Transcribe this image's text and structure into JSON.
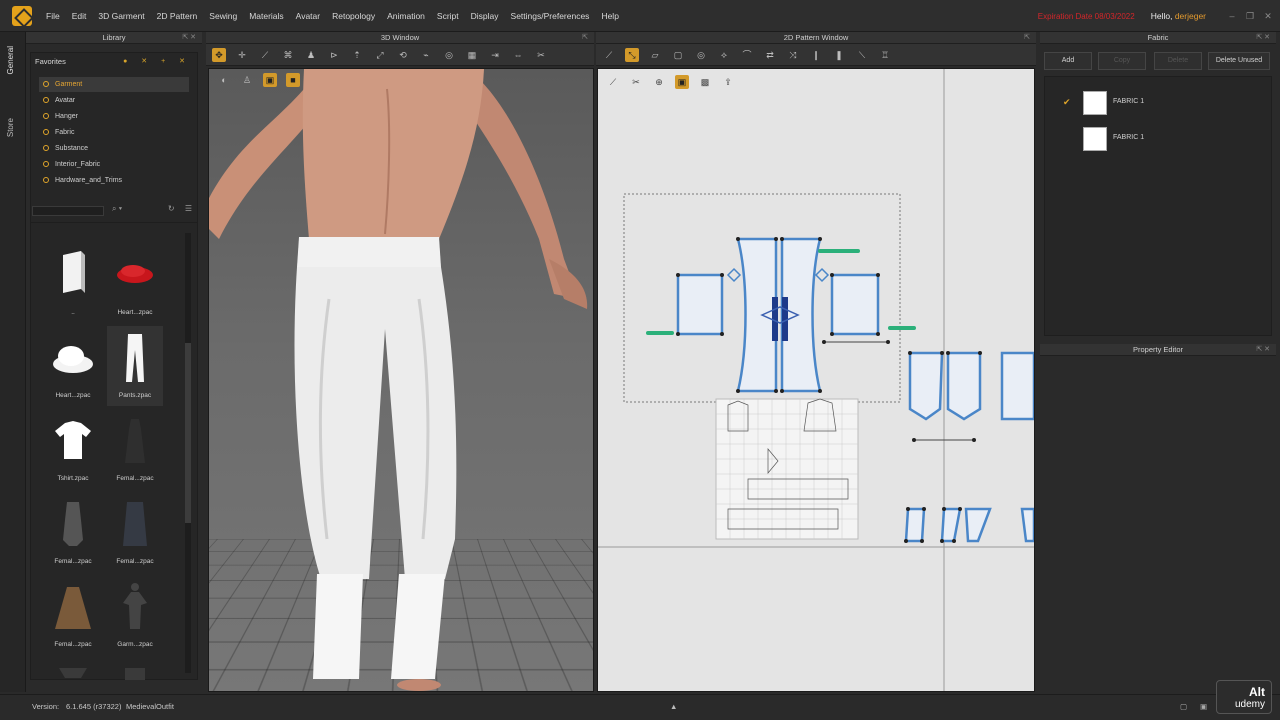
{
  "app": {
    "title": "CLO"
  },
  "menu": [
    "File",
    "Edit",
    "3D Garment",
    "2D Pattern",
    "Sewing",
    "Materials",
    "Avatar",
    "Retopology",
    "Animation",
    "Script",
    "Display",
    "Settings/Preferences",
    "Help"
  ],
  "header": {
    "expiration": "Expiration Date 08/03/2022",
    "hello": "Hello,",
    "user": "derjeger"
  },
  "side_tabs": {
    "general": "General",
    "store": "Store"
  },
  "library": {
    "title": "Library",
    "favorites_title": "Favorites",
    "favorites": [
      "Garment",
      "Avatar",
      "Hanger",
      "Fabric",
      "Substance",
      "Interior_Fabric",
      "Hardware_and_Trims"
    ],
    "selected": "Garment",
    "items": [
      {
        "label": ".."
      },
      {
        "label": "Heart...zpac"
      },
      {
        "label": "Heart...zpac"
      },
      {
        "label": "Pants.zpac"
      },
      {
        "label": "Tshirt.zpac"
      },
      {
        "label": "Femal...zpac"
      },
      {
        "label": "Femal...zpac"
      },
      {
        "label": "Femal...zpac"
      },
      {
        "label": "Femal...zpac"
      },
      {
        "label": "Garm...zpac"
      },
      {
        "label": ""
      },
      {
        "label": ""
      }
    ]
  },
  "window3d": {
    "title": "3D Window"
  },
  "window2d": {
    "title": "2D Pattern Window"
  },
  "fabric": {
    "title": "Fabric",
    "buttons": {
      "add": "Add",
      "copy": "Copy",
      "delete": "Delete",
      "delete_unused": "Delete Unused"
    },
    "items": [
      {
        "name": "FABRIC 1",
        "checked": true
      },
      {
        "name": "FABRIC 1",
        "checked": false
      }
    ]
  },
  "property_editor": {
    "title": "Property Editor"
  },
  "status": {
    "version_label": "Version:",
    "version": "6.1.645 (r37322)",
    "file": "MedievalOutfit"
  },
  "watermark": {
    "alt": "Alt",
    "udemy": "udemy"
  },
  "colors": {
    "accent": "#e0a52a",
    "expiry": "#d3262a",
    "pattern_fill": "#e9eef6",
    "pattern_stroke": "#4a86c8"
  }
}
